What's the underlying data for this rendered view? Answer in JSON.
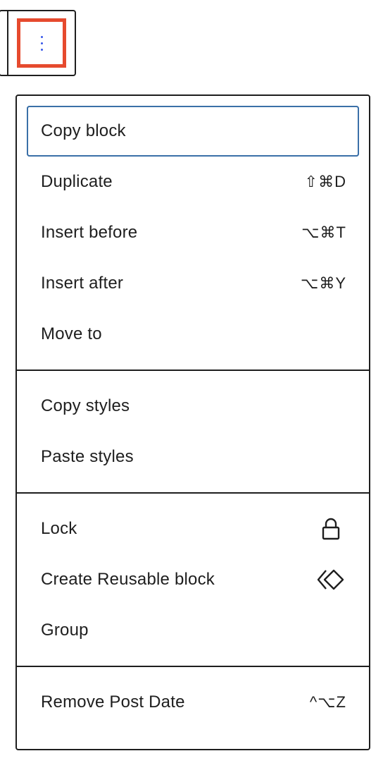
{
  "menu": {
    "groups": [
      {
        "items": [
          {
            "label": "Copy block",
            "shortcut": ""
          },
          {
            "label": "Duplicate",
            "shortcut": "⇧⌘D"
          },
          {
            "label": "Insert before",
            "shortcut": "⌥⌘T"
          },
          {
            "label": "Insert after",
            "shortcut": "⌥⌘Y"
          },
          {
            "label": "Move to",
            "shortcut": ""
          }
        ]
      },
      {
        "items": [
          {
            "label": "Copy styles"
          },
          {
            "label": "Paste styles"
          }
        ]
      },
      {
        "items": [
          {
            "label": "Lock",
            "icon": "lock-icon"
          },
          {
            "label": "Create Reusable block",
            "icon": "reusable-block-icon"
          },
          {
            "label": "Group"
          }
        ]
      },
      {
        "items": [
          {
            "label": "Remove Post Date",
            "shortcut": "^⌥Z"
          }
        ]
      }
    ]
  },
  "colors": {
    "highlight": "#e64a2e",
    "focus": "#3b70a8",
    "text": "#1e1e1e"
  }
}
